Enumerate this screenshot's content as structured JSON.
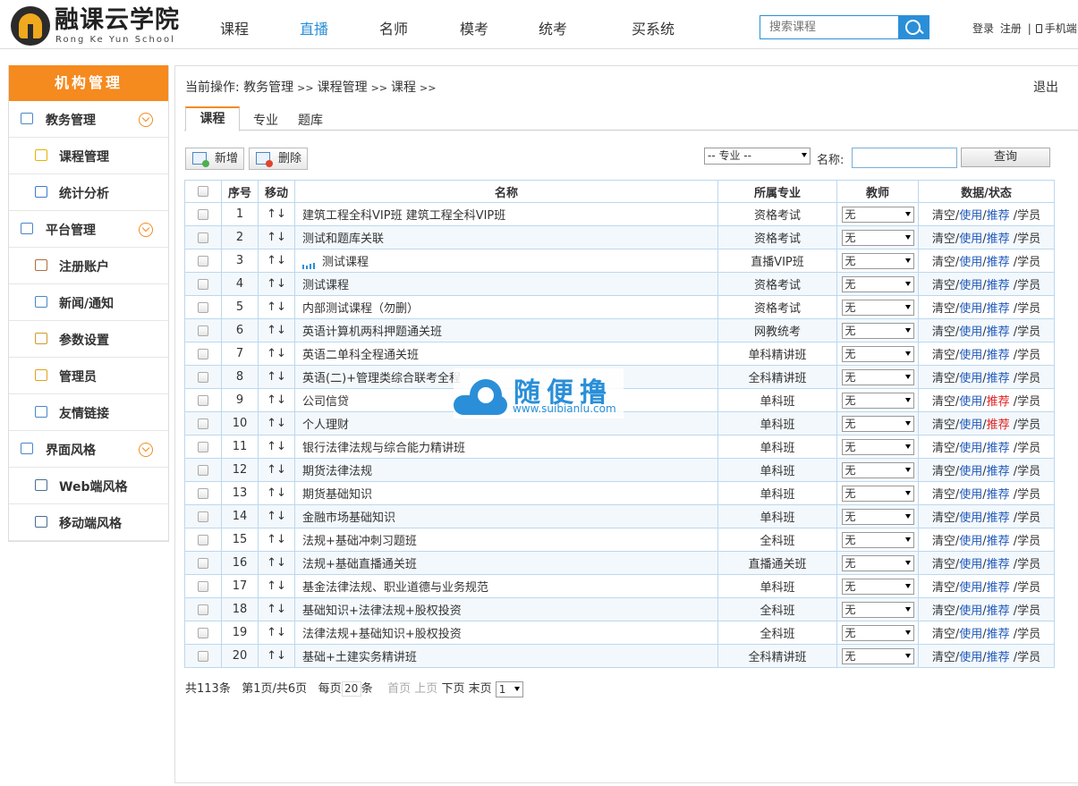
{
  "header": {
    "logo_title": "融课云学院",
    "logo_subtitle": "Rong Ke Yun School",
    "nav": [
      {
        "label": "课程",
        "active": false
      },
      {
        "label": "直播",
        "active": true
      },
      {
        "label": "名师",
        "active": false
      },
      {
        "label": "模考",
        "active": false
      },
      {
        "label": "统考",
        "active": false
      },
      {
        "label": "买系统",
        "active": false
      }
    ],
    "search_placeholder": "搜索课程",
    "login": "登录",
    "register": "注册",
    "divider": "|",
    "mobile": "手机端",
    "accent_color": "#2a8fd8"
  },
  "sidebar": {
    "title": "机构管理",
    "title_color": "#f58a1f",
    "items": [
      {
        "label": "教务管理",
        "type": "group",
        "icon": "book-100-icon"
      },
      {
        "label": "课程管理",
        "type": "sub",
        "icon": "notebook-icon"
      },
      {
        "label": "统计分析",
        "type": "sub",
        "icon": "bar-chart-icon"
      },
      {
        "label": "平台管理",
        "type": "group",
        "icon": "calendar-grid-icon"
      },
      {
        "label": "注册账户",
        "type": "sub",
        "icon": "id-card-icon"
      },
      {
        "label": "新闻/通知",
        "type": "sub",
        "icon": "open-book-icon"
      },
      {
        "label": "参数设置",
        "type": "sub",
        "icon": "gear-icon"
      },
      {
        "label": "管理员",
        "type": "sub",
        "icon": "key-icon"
      },
      {
        "label": "友情链接",
        "type": "sub",
        "icon": "user-link-icon"
      },
      {
        "label": "界面风格",
        "type": "group",
        "icon": "window-icon"
      },
      {
        "label": "Web端风格",
        "type": "sub",
        "icon": "monitor-icon"
      },
      {
        "label": "移动端风格",
        "type": "sub",
        "icon": "line-chart-icon"
      }
    ]
  },
  "main": {
    "breadcrumb_prefix": "当前操作:",
    "breadcrumb": [
      "教务管理",
      "课程管理",
      "课程"
    ],
    "breadcrumb_sep": ">>",
    "logout": "退出",
    "tabs": [
      "课程",
      "专业",
      "题库"
    ],
    "toolbar": {
      "add_label": "新增",
      "delete_label": "删除",
      "major_select": "-- 专业 --",
      "name_label": "名称:",
      "query_label": "查询"
    },
    "table": {
      "headers": [
        "",
        "序号",
        "移动",
        "名称",
        "所属专业",
        "教师",
        "数据/状态"
      ],
      "move_glyph": "↑↓",
      "teacher_default": "无",
      "actions": {
        "clear": "清空",
        "use": "使用",
        "recommend": "推荐",
        "students": "学员",
        "slash": "/"
      },
      "rows": [
        {
          "no": "1",
          "name": "建筑工程全科VIP班 建筑工程全科VIP班",
          "major": "资格考试",
          "live": false,
          "recommend_red": false
        },
        {
          "no": "2",
          "name": "测试和题库关联",
          "major": "资格考试",
          "live": false,
          "recommend_red": false
        },
        {
          "no": "3",
          "name": "测试课程",
          "major": "直播VIP班",
          "live": true,
          "recommend_red": false
        },
        {
          "no": "4",
          "name": "测试课程",
          "major": "资格考试",
          "live": false,
          "recommend_red": false
        },
        {
          "no": "5",
          "name": "内部测试课程（勿删）",
          "major": "资格考试",
          "live": false,
          "recommend_red": false
        },
        {
          "no": "6",
          "name": "英语计算机两科押题通关班",
          "major": "网教统考",
          "live": false,
          "recommend_red": false
        },
        {
          "no": "7",
          "name": "英语二单科全程通关班",
          "major": "单科精讲班",
          "live": false,
          "recommend_red": false
        },
        {
          "no": "8",
          "name": "英语(二)+管理类综合联考全程",
          "major": "全科精讲班",
          "live": false,
          "recommend_red": false
        },
        {
          "no": "9",
          "name": "公司信贷",
          "major": "单科班",
          "live": false,
          "recommend_red": true
        },
        {
          "no": "10",
          "name": "个人理财",
          "major": "单科班",
          "live": false,
          "recommend_red": true
        },
        {
          "no": "11",
          "name": "银行法律法规与综合能力精讲班",
          "major": "单科班",
          "live": false,
          "recommend_red": false
        },
        {
          "no": "12",
          "name": "期货法律法规",
          "major": "单科班",
          "live": false,
          "recommend_red": false
        },
        {
          "no": "13",
          "name": "期货基础知识",
          "major": "单科班",
          "live": false,
          "recommend_red": false
        },
        {
          "no": "14",
          "name": "金融市场基础知识",
          "major": "单科班",
          "live": false,
          "recommend_red": false
        },
        {
          "no": "15",
          "name": "法规+基础冲刺习题班",
          "major": "全科班",
          "live": false,
          "recommend_red": false
        },
        {
          "no": "16",
          "name": "法规+基础直播通关班",
          "major": "直播通关班",
          "live": false,
          "recommend_red": false
        },
        {
          "no": "17",
          "name": "基金法律法规、职业道德与业务规范",
          "major": "单科班",
          "live": false,
          "recommend_red": false
        },
        {
          "no": "18",
          "name": "基础知识+法律法规+股权投资",
          "major": "全科班",
          "live": false,
          "recommend_red": false
        },
        {
          "no": "19",
          "name": "法律法规+基础知识+股权投资",
          "major": "全科班",
          "live": false,
          "recommend_red": false
        },
        {
          "no": "20",
          "name": "基础+土建实务精讲班",
          "major": "全科精讲班",
          "live": false,
          "recommend_red": false
        }
      ]
    },
    "pager": {
      "total": "共113条",
      "page_info": "第1页/共6页",
      "per_page_prefix": "每页",
      "per_page": "20",
      "per_page_suffix": "条",
      "first": "首页",
      "prev": "上页",
      "next": "下页",
      "last": "末页",
      "page_select": "1"
    }
  },
  "watermark": {
    "title": "随便撸",
    "url": "www.suibianlu.com"
  }
}
